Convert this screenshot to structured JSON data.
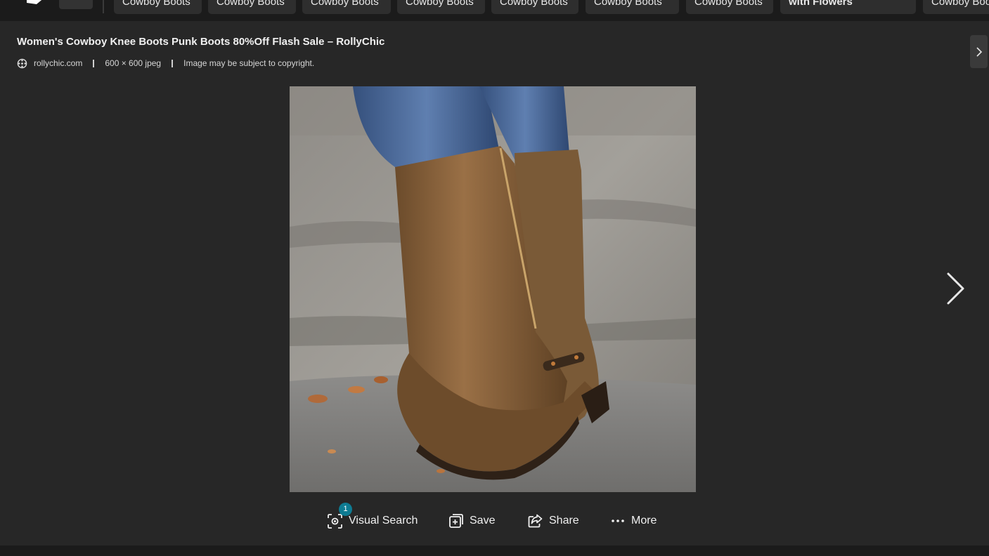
{
  "related_searches": [
    {
      "label": "Cowboy Boots"
    },
    {
      "label": "Cowboy Boots"
    },
    {
      "label": "Cowboy Boots"
    },
    {
      "label": "Cowboy Boots"
    },
    {
      "label": "Cowboy Boots"
    },
    {
      "label": "Cowboy Boots"
    },
    {
      "label": "Cowboy Boots"
    },
    {
      "label": "with Flowers"
    },
    {
      "label": "Cowboy Boo"
    }
  ],
  "detail": {
    "title": "Women's Cowboy Knee Boots Punk Boots 80%Off Flash Sale – RollyChic",
    "source": "rollychic.com",
    "dimensions": "600 × 600 jpeg",
    "copyright": "Image may be subject to copyright."
  },
  "actions": {
    "visual_search": "Visual Search",
    "visual_search_badge": "1",
    "save": "Save",
    "share": "Share",
    "more": "More"
  },
  "icons": {
    "source": "globe-icon",
    "next": "chevron-right-icon",
    "visual_search": "visual-search-icon",
    "save": "save-collection-icon",
    "share": "share-icon",
    "more": "more-dots-icon"
  },
  "colors": {
    "panel_bg": "#272727",
    "page_bg": "#1b1b1b",
    "chip_bg": "#2e2e2e",
    "badge": "#0e7b92"
  }
}
